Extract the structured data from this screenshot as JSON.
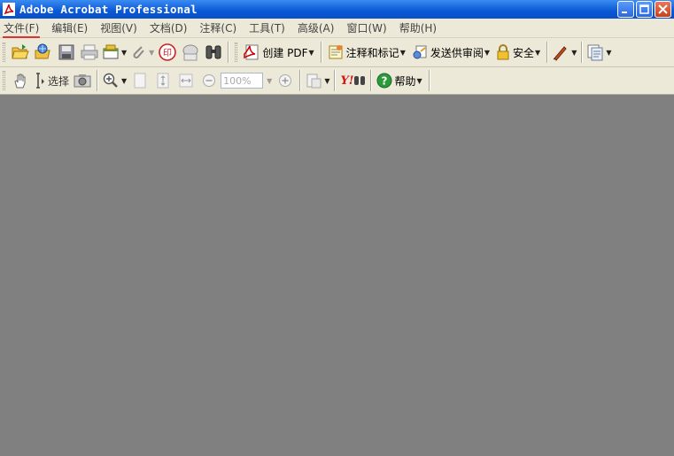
{
  "window": {
    "title": "Adobe Acrobat Professional",
    "controls": [
      "minimize",
      "maximize",
      "close"
    ]
  },
  "menubar": {
    "items": [
      {
        "label": "文件(F)"
      },
      {
        "label": "编辑(E)"
      },
      {
        "label": "视图(V)"
      },
      {
        "label": "文档(D)"
      },
      {
        "label": "注释(C)"
      },
      {
        "label": "工具(T)"
      },
      {
        "label": "高级(A)"
      },
      {
        "label": "窗口(W)"
      },
      {
        "label": "帮助(H)"
      }
    ]
  },
  "toolbar1": {
    "icons": [
      "open-icon",
      "organizer-icon",
      "save-icon",
      "print-icon",
      "email-icon",
      "attach-icon",
      "stamp-icon",
      "comment-icon",
      "search-icon"
    ],
    "create_pdf_label": "创建 PDF",
    "comment_markup_label": "注释和标记",
    "send_review_label": "发送供审阅",
    "security_label": "安全",
    "sign_icon": "pen-icon",
    "forms_icon": "forms-icon"
  },
  "toolbar2": {
    "select_label": "选择",
    "zoom_value": "100%",
    "help_label": "帮助",
    "yahoo_label": "Y!"
  }
}
